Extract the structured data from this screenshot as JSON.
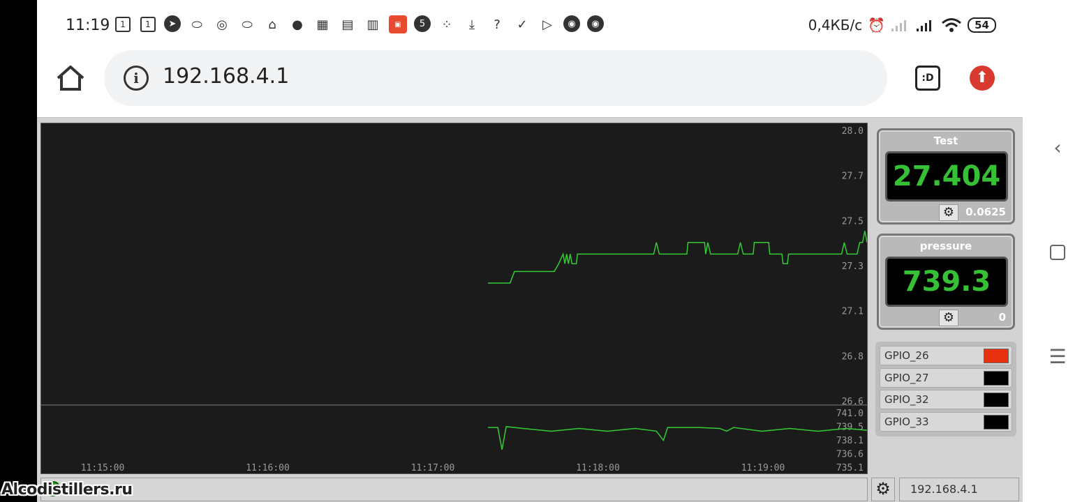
{
  "status_bar": {
    "time": "11:19",
    "network_speed": "0,4КБ/с",
    "battery": "54",
    "icons": [
      "calendar-icon",
      "calendar-icon",
      "telegram-icon",
      "oval-icon",
      "location-ring-icon",
      "oval-icon",
      "home-icon",
      "map-pin-icon",
      "app-icon",
      "app-icon",
      "trash-icon",
      "aliexpress-icon",
      "number-5-icon",
      "dots-icon",
      "download-icon",
      "wifi-question-icon",
      "check-icon",
      "play-store-icon",
      "chrome-icon",
      "chrome-icon"
    ]
  },
  "browser": {
    "url": "192.168.4.1",
    "info_glyph": "i",
    "d_icon_label": ":D"
  },
  "chart_data": [
    {
      "type": "line",
      "series": [
        {
          "values": [
            [
              11.1785,
              27.21
            ],
            [
              11.1795,
              27.21
            ],
            [
              11.1797,
              27.27
            ],
            [
              11.1815,
              27.27
            ],
            [
              11.1817,
              27.31
            ],
            [
              11.1819,
              27.36
            ],
            [
              11.18198,
              27.31
            ],
            [
              11.18206,
              27.36
            ],
            [
              11.18214,
              27.31
            ],
            [
              11.18222,
              27.36
            ],
            [
              11.1823,
              27.31
            ],
            [
              11.1825,
              27.31
            ],
            [
              11.18255,
              27.36
            ],
            [
              11.186,
              27.36
            ],
            [
              11.18612,
              27.42
            ],
            [
              11.18625,
              27.36
            ],
            [
              11.1875,
              27.36
            ],
            [
              11.18755,
              27.42
            ],
            [
              11.1883,
              27.42
            ],
            [
              11.18835,
              27.36
            ],
            [
              11.18845,
              27.42
            ],
            [
              11.18857,
              27.36
            ],
            [
              11.1898,
              27.36
            ],
            [
              11.18992,
              27.42
            ],
            [
              11.19005,
              27.36
            ],
            [
              11.1905,
              27.36
            ],
            [
              11.19055,
              27.42
            ],
            [
              11.1912,
              27.42
            ],
            [
              11.19125,
              27.36
            ],
            [
              11.1918,
              27.36
            ],
            [
              11.19185,
              27.31
            ],
            [
              11.19205,
              27.31
            ],
            [
              11.1921,
              27.36
            ],
            [
              11.1945,
              27.36
            ],
            [
              11.19462,
              27.42
            ],
            [
              11.19475,
              27.36
            ],
            [
              11.1952,
              27.36
            ],
            [
              11.19532,
              27.42
            ],
            [
              11.19545,
              27.42
            ],
            [
              11.19555,
              27.48
            ],
            [
              11.19565,
              27.42
            ]
          ]
        }
      ],
      "ylim": [
        26.6,
        28.0
      ],
      "ytick_labels": [
        "28.0",
        "27.7",
        "27.5",
        "27.3",
        "27.1",
        "26.8",
        "26.6"
      ],
      "grid": false
    },
    {
      "type": "line",
      "series": [
        {
          "values": [
            [
              11.1785,
              739.4
            ],
            [
              11.1792,
              739.4
            ],
            [
              11.1795,
              737.0
            ],
            [
              11.1798,
              739.5
            ],
            [
              11.181,
              739.3
            ],
            [
              11.183,
              739.0
            ],
            [
              11.185,
              739.3
            ],
            [
              11.187,
              739.0
            ],
            [
              11.189,
              739.3
            ],
            [
              11.1905,
              739.0
            ],
            [
              11.191,
              738.0
            ],
            [
              11.1913,
              739.4
            ],
            [
              11.1935,
              739.4
            ],
            [
              11.195,
              739.3
            ],
            [
              11.1955,
              739.0
            ],
            [
              11.196,
              739.4
            ],
            [
              11.198,
              739.0
            ],
            [
              11.2,
              739.3
            ],
            [
              11.202,
              739.0
            ],
            [
              11.204,
              739.3
            ],
            [
              11.2055,
              739.1
            ]
          ]
        }
      ],
      "ylim": [
        735.1,
        741.0
      ],
      "ytick_labels": [
        "741.0",
        "739.5",
        "738.1",
        "736.6",
        "735.1"
      ],
      "xtick_labels": [
        "11:15:00",
        "11:16:00",
        "11:17:00",
        "11:18:00",
        "11:19:00"
      ],
      "grid": false
    }
  ],
  "sensors": [
    {
      "title": "Test",
      "value": "27.404",
      "setting": "0.0625"
    },
    {
      "title": "pressure",
      "value": "739.3",
      "setting": "0"
    }
  ],
  "gpio": [
    {
      "label": "GPIO_26",
      "color": "#e8320f"
    },
    {
      "label": "GPIO_27",
      "color": "#000000"
    },
    {
      "label": "GPIO_32",
      "color": "#000000"
    },
    {
      "label": "GPIO_33",
      "color": "#000000"
    }
  ],
  "footer": {
    "ip": "192.168.4.1",
    "led_glyph": "●"
  },
  "watermark": "Alcodistillers.ru",
  "colors": {
    "line": "#33cc33",
    "lcd_text": "#35c035",
    "chart_bg": "#1b1b1b"
  }
}
